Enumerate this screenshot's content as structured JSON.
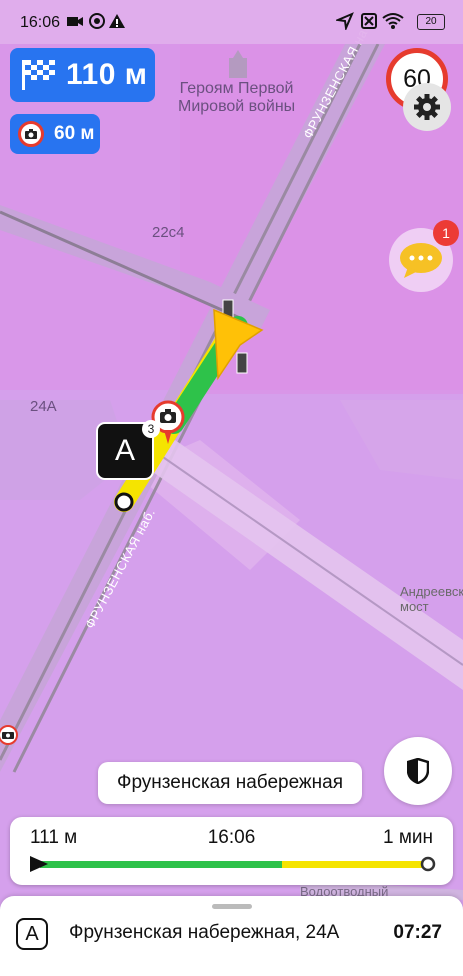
{
  "status_bar": {
    "time": "16:06",
    "battery": "20"
  },
  "maneuver": {
    "distance": "110 м"
  },
  "camera": {
    "distance": "60 м"
  },
  "speed_limit": "60",
  "chat": {
    "badge": "1"
  },
  "map": {
    "labels": {
      "poi": "Героям Первой\nМировой войны",
      "building_22c4": "22с4",
      "building_24a": "24А",
      "street_top": "ФРУНЗЕНСКАЯ наб.",
      "street_bottom": "ФРУНЗЕНСКАЯ наб.",
      "bridge": "Андреевский\nмост",
      "bottom_road": "Водоотводный"
    },
    "marker_a": {
      "label": "A",
      "count": "3"
    }
  },
  "current_street": "Фрунзенская набережная",
  "progress": {
    "remaining_distance": "111 м",
    "arrival_time": "16:06",
    "remaining_time": "1 мин"
  },
  "destination": {
    "icon_label": "A",
    "address": "Фрунзенская набережная, 24А",
    "time": "07:27"
  },
  "colors": {
    "accent_blue": "#2874f0",
    "alert_red": "#e63b2e",
    "route_green": "#2ec24a",
    "route_yellow": "#f5e400",
    "map_purple": "#d89ae6"
  }
}
